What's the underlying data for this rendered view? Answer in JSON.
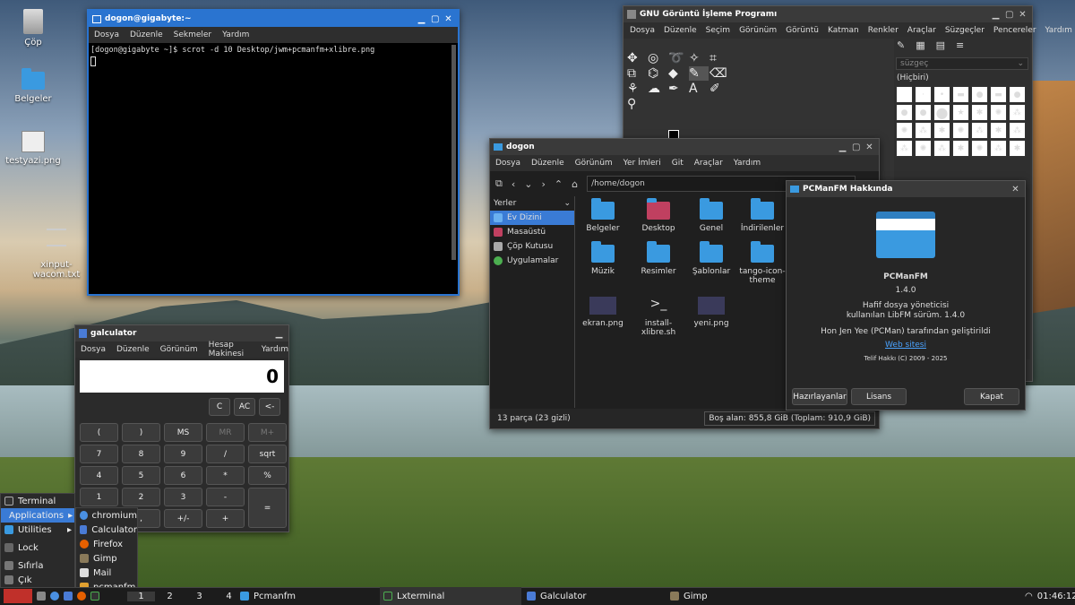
{
  "desktop": {
    "icons": [
      "Çöp",
      "Belgeler",
      "testyazi.png",
      "xinput-\nwacom.txt"
    ]
  },
  "terminal": {
    "title": "dogon@gigabyte:~",
    "menu": [
      "Dosya",
      "Düzenle",
      "Sekmeler",
      "Yardım"
    ],
    "line": "[dogon@gigabyte ~]$ scrot -d 10 Desktop/jwm+pcmanfm+xlibre.png"
  },
  "gimp": {
    "title": "GNU Görüntü İşleme Programı",
    "menu": [
      "Dosya",
      "Düzenle",
      "Seçim",
      "Görünüm",
      "Görüntü",
      "Katman",
      "Renkler",
      "Araçlar",
      "Süzgeçler",
      "Pencereler",
      "Yardım"
    ],
    "filter_placeholder": "süzgeç",
    "brush_label": "(Hiçbiri)"
  },
  "pcmanfm": {
    "title": "dogon",
    "menu": [
      "Dosya",
      "Düzenle",
      "Görünüm",
      "Yer İmleri",
      "Git",
      "Araçlar",
      "Yardım"
    ],
    "path": "/home/dogon",
    "places_header": "Yerler",
    "places": [
      "Ev Dizini",
      "Masaüstü",
      "Çöp Kutusu",
      "Uygulamalar"
    ],
    "files": [
      "Belgeler",
      "Desktop",
      "Genel",
      "İndirilenler",
      "Müzik",
      "Resimler",
      "Şablonlar",
      "tango-icon-\ntheme",
      "ekran.png",
      "install-\nxlibre.sh",
      "yeni.png"
    ],
    "status_left": "13 parça (23 gizli)",
    "status_right": "Boş alan: 855,8 GiB (Toplam: 910,9 GiB)"
  },
  "about": {
    "title": "PCManFM Hakkında",
    "name": "PCManFM",
    "version": "1.4.0",
    "desc1": "Hafif dosya yöneticisi",
    "desc2": "kullanılan LibFM sürüm. 1.4.0",
    "author": "Hon Jen Yee (PCMan) tarafından geliştirildi",
    "link": "Web sitesi",
    "copyright": "Telif Hakkı (C) 2009 - 2025",
    "btn_credits": "Hazırlayanlar",
    "btn_license": "Lisans",
    "btn_close": "Kapat"
  },
  "calc": {
    "title": "galculator",
    "menu": [
      "Dosya",
      "Düzenle",
      "Görünüm",
      "Hesap Makinesi",
      "Yardım"
    ],
    "display": "0",
    "row0": [
      "C",
      "AC",
      "<-"
    ],
    "row1": [
      "(",
      ")",
      "MS",
      "MR",
      "M+"
    ],
    "row2": [
      "7",
      "8",
      "9",
      "/",
      "sqrt"
    ],
    "row3": [
      "4",
      "5",
      "6",
      "*",
      "%"
    ],
    "row4": [
      "1",
      "2",
      "3",
      "-",
      "="
    ],
    "row5": [
      "0",
      ",",
      "+/-",
      "+"
    ]
  },
  "startmenu": {
    "items": [
      "Terminal",
      "Applications",
      "Utilities",
      "Lock",
      "Sıfırla",
      "Çık"
    ],
    "apps": [
      "chromium",
      "Calculator",
      "Firefox",
      "Gimp",
      "Mail",
      "pcmanfm"
    ]
  },
  "taskbar": {
    "desktops": [
      "1",
      "2",
      "3",
      "4"
    ],
    "tasks": [
      "Pcmanfm",
      "Lxterminal",
      "Galculator",
      "Gimp"
    ],
    "clock": "01:46:12"
  }
}
